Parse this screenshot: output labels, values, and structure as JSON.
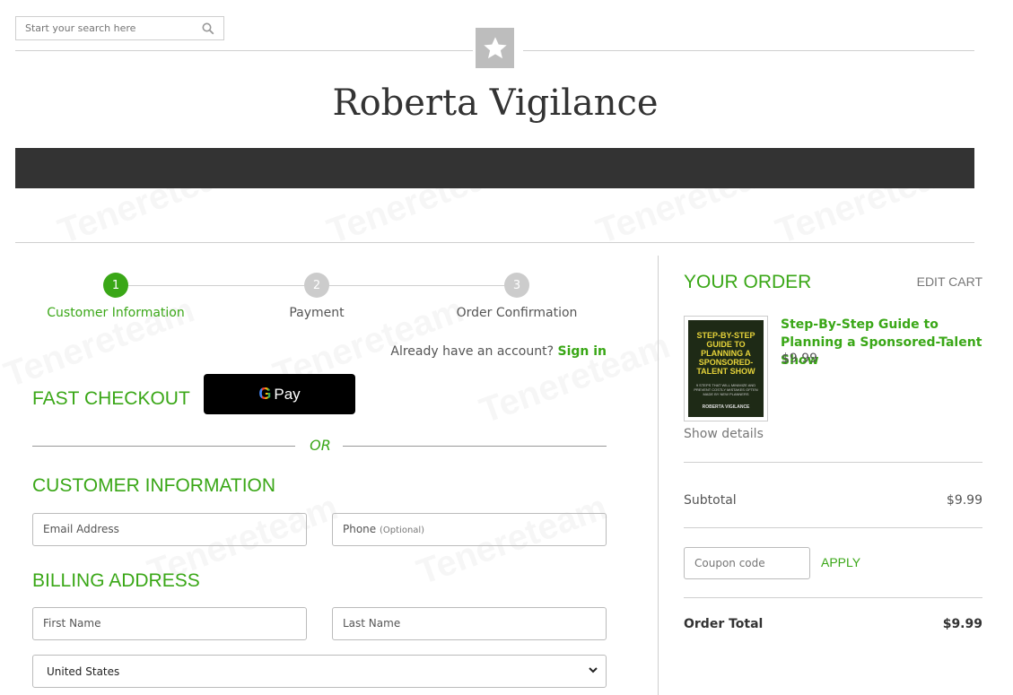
{
  "search": {
    "placeholder": "Start your search here"
  },
  "site": {
    "title": "Roberta Vigilance"
  },
  "steps": [
    {
      "num": "1",
      "label": "Customer Information",
      "active": true
    },
    {
      "num": "2",
      "label": "Payment",
      "active": false
    },
    {
      "num": "3",
      "label": "Order Confirmation",
      "active": false
    }
  ],
  "account": {
    "prompt": "Already have an account?",
    "link": "Sign in"
  },
  "fast_checkout": {
    "heading": "FAST CHECKOUT",
    "gpay_g": "G",
    "gpay_label": "Pay"
  },
  "divider": {
    "or": "OR"
  },
  "customer": {
    "heading": "CUSTOMER INFORMATION",
    "email_label": "Email Address",
    "phone_label": "Phone",
    "phone_optional": "(Optional)"
  },
  "billing": {
    "heading": "BILLING ADDRESS",
    "first_name": "First Name",
    "last_name": "Last Name",
    "country": "United States"
  },
  "order": {
    "heading": "YOUR ORDER",
    "edit_cart": "EDIT CART",
    "product": {
      "title": "Step-By-Step Guide to Planning a Sponsored-Talent Show",
      "price": "$9.99",
      "cover_title": "STEP-BY-STEP GUIDE TO PLANNING A SPONSORED-TALENT SHOW",
      "cover_sub": "9 STEPS THAT WILL MINIMIZE AND PREVENT COSTLY MISTAKES OFTEN MADE BY NEW PLANNERS",
      "cover_author": "ROBERTA VIGILANCE"
    },
    "show_details": "Show details",
    "subtotal_label": "Subtotal",
    "subtotal_value": "$9.99",
    "coupon_placeholder": "Coupon code",
    "apply_label": "APPLY",
    "total_label": "Order Total",
    "total_value": "$9.99"
  },
  "colors": {
    "accent": "#3aa717",
    "inactive_step": "#cccccc",
    "navbar": "#333333"
  },
  "watermark": "Tenereteam"
}
